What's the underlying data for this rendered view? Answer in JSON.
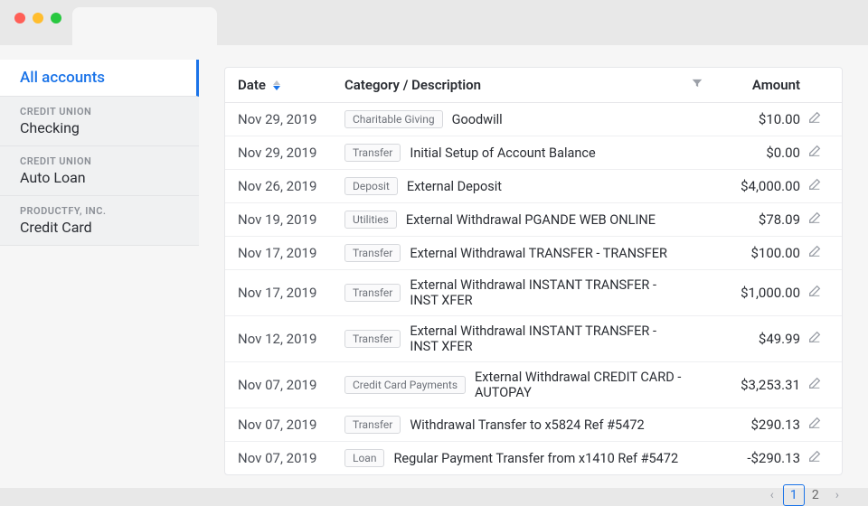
{
  "sidebar": {
    "active_label": "All accounts",
    "items": [
      {
        "institution": "CREDIT UNION",
        "name": "Checking"
      },
      {
        "institution": "CREDIT UNION",
        "name": "Auto Loan"
      },
      {
        "institution": "PRODUCTFY, INC.",
        "name": "Credit Card"
      }
    ]
  },
  "table": {
    "headers": {
      "date": "Date",
      "category": "Category / Description",
      "amount": "Amount"
    },
    "rows": [
      {
        "date": "Nov 29, 2019",
        "category": "Charitable Giving",
        "description": "Goodwill",
        "amount": "$10.00"
      },
      {
        "date": "Nov 29, 2019",
        "category": "Transfer",
        "description": "Initial Setup of Account Balance",
        "amount": "$0.00"
      },
      {
        "date": "Nov 26, 2019",
        "category": "Deposit",
        "description": "External Deposit",
        "amount": "$4,000.00"
      },
      {
        "date": "Nov 19, 2019",
        "category": "Utilities",
        "description": "External Withdrawal PGANDE WEB ONLINE",
        "amount": "$78.09"
      },
      {
        "date": "Nov 17, 2019",
        "category": "Transfer",
        "description": "External Withdrawal TRANSFER - TRANSFER",
        "amount": "$100.00"
      },
      {
        "date": "Nov 17, 2019",
        "category": "Transfer",
        "description": "External Withdrawal INSTANT TRANSFER - INST XFER",
        "amount": "$1,000.00"
      },
      {
        "date": "Nov 12, 2019",
        "category": "Transfer",
        "description": "External Withdrawal INSTANT TRANSFER - INST XFER",
        "amount": "$49.99"
      },
      {
        "date": "Nov 07, 2019",
        "category": "Credit Card Payments",
        "description": "External Withdrawal CREDIT CARD - AUTOPAY",
        "amount": "$3,253.31"
      },
      {
        "date": "Nov 07, 2019",
        "category": "Transfer",
        "description": "Withdrawal Transfer to x5824 Ref #5472",
        "amount": "$290.13"
      },
      {
        "date": "Nov 07, 2019",
        "category": "Loan",
        "description": "Regular Payment Transfer from x1410 Ref #5472",
        "amount": "-$290.13"
      }
    ]
  },
  "pagination": {
    "pages": [
      "1",
      "2"
    ],
    "current": "1"
  }
}
